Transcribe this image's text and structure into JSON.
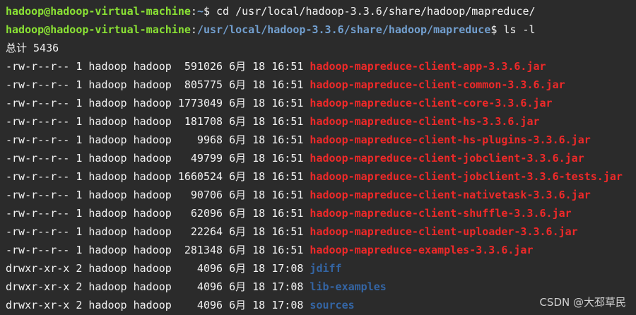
{
  "terminal": {
    "lines": [
      {
        "type": "prompt",
        "user": "hadoop@hadoop-virtual-machine",
        "sep": ":",
        "cwd": "~",
        "sym": "$",
        "cmd": " cd /usr/local/hadoop-3.3.6/share/hadoop/mapreduce/"
      },
      {
        "type": "prompt",
        "user": "hadoop@hadoop-virtual-machine",
        "sep": ":",
        "cwd": "/usr/local/hadoop-3.3.6/share/hadoop/mapreduce",
        "sym": "$",
        "cmd": " ls -l"
      },
      {
        "type": "text",
        "text": "总计 5436"
      },
      {
        "type": "entry",
        "perms": "-rw-r--r--",
        "links": "1",
        "owner": "hadoop",
        "group": "hadoop",
        "size": "591026",
        "month": "6月",
        "day": "18",
        "time": "16:51",
        "name": "hadoop-mapreduce-client-app-3.3.6.jar",
        "kind": "jar"
      },
      {
        "type": "entry",
        "perms": "-rw-r--r--",
        "links": "1",
        "owner": "hadoop",
        "group": "hadoop",
        "size": "805775",
        "month": "6月",
        "day": "18",
        "time": "16:51",
        "name": "hadoop-mapreduce-client-common-3.3.6.jar",
        "kind": "jar"
      },
      {
        "type": "entry",
        "perms": "-rw-r--r--",
        "links": "1",
        "owner": "hadoop",
        "group": "hadoop",
        "size": "1773049",
        "month": "6月",
        "day": "18",
        "time": "16:51",
        "name": "hadoop-mapreduce-client-core-3.3.6.jar",
        "kind": "jar"
      },
      {
        "type": "entry",
        "perms": "-rw-r--r--",
        "links": "1",
        "owner": "hadoop",
        "group": "hadoop",
        "size": "181708",
        "month": "6月",
        "day": "18",
        "time": "16:51",
        "name": "hadoop-mapreduce-client-hs-3.3.6.jar",
        "kind": "jar"
      },
      {
        "type": "entry",
        "perms": "-rw-r--r--",
        "links": "1",
        "owner": "hadoop",
        "group": "hadoop",
        "size": "9968",
        "month": "6月",
        "day": "18",
        "time": "16:51",
        "name": "hadoop-mapreduce-client-hs-plugins-3.3.6.jar",
        "kind": "jar"
      },
      {
        "type": "entry",
        "perms": "-rw-r--r--",
        "links": "1",
        "owner": "hadoop",
        "group": "hadoop",
        "size": "49799",
        "month": "6月",
        "day": "18",
        "time": "16:51",
        "name": "hadoop-mapreduce-client-jobclient-3.3.6.jar",
        "kind": "jar"
      },
      {
        "type": "entry",
        "perms": "-rw-r--r--",
        "links": "1",
        "owner": "hadoop",
        "group": "hadoop",
        "size": "1660524",
        "month": "6月",
        "day": "18",
        "time": "16:51",
        "name": "hadoop-mapreduce-client-jobclient-3.3.6-tests.jar",
        "kind": "jar"
      },
      {
        "type": "entry",
        "perms": "-rw-r--r--",
        "links": "1",
        "owner": "hadoop",
        "group": "hadoop",
        "size": "90706",
        "month": "6月",
        "day": "18",
        "time": "16:51",
        "name": "hadoop-mapreduce-client-nativetask-3.3.6.jar",
        "kind": "jar"
      },
      {
        "type": "entry",
        "perms": "-rw-r--r--",
        "links": "1",
        "owner": "hadoop",
        "group": "hadoop",
        "size": "62096",
        "month": "6月",
        "day": "18",
        "time": "16:51",
        "name": "hadoop-mapreduce-client-shuffle-3.3.6.jar",
        "kind": "jar"
      },
      {
        "type": "entry",
        "perms": "-rw-r--r--",
        "links": "1",
        "owner": "hadoop",
        "group": "hadoop",
        "size": "22264",
        "month": "6月",
        "day": "18",
        "time": "16:51",
        "name": "hadoop-mapreduce-client-uploader-3.3.6.jar",
        "kind": "jar"
      },
      {
        "type": "entry",
        "perms": "-rw-r--r--",
        "links": "1",
        "owner": "hadoop",
        "group": "hadoop",
        "size": "281348",
        "month": "6月",
        "day": "18",
        "time": "16:51",
        "name": "hadoop-mapreduce-examples-3.3.6.jar",
        "kind": "jar"
      },
      {
        "type": "entry",
        "perms": "drwxr-xr-x",
        "links": "2",
        "owner": "hadoop",
        "group": "hadoop",
        "size": "4096",
        "month": "6月",
        "day": "18",
        "time": "17:08",
        "name": "jdiff",
        "kind": "dir"
      },
      {
        "type": "entry",
        "perms": "drwxr-xr-x",
        "links": "2",
        "owner": "hadoop",
        "group": "hadoop",
        "size": "4096",
        "month": "6月",
        "day": "18",
        "time": "17:08",
        "name": "lib-examples",
        "kind": "dir"
      },
      {
        "type": "entry",
        "perms": "drwxr-xr-x",
        "links": "2",
        "owner": "hadoop",
        "group": "hadoop",
        "size": "4096",
        "month": "6月",
        "day": "18",
        "time": "17:08",
        "name": "sources",
        "kind": "dir"
      }
    ]
  },
  "watermark": "CSDN @大邳草民",
  "colors": {
    "background": "#2b2b2b",
    "prompt_user": "#8ae234",
    "prompt_path": "#729fcf",
    "jar_file": "#ef2929",
    "directory": "#3465a4",
    "text": "#f2f2f2"
  }
}
